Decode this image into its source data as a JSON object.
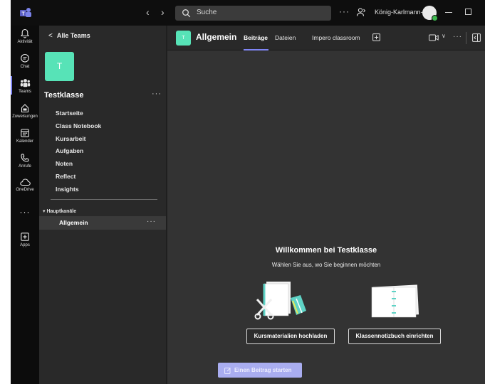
{
  "titlebar": {
    "search_placeholder": "Suche",
    "more": "···",
    "user_name": "König-Karlmann-...",
    "nav_back": "‹",
    "nav_forward": "›"
  },
  "rail": {
    "items": [
      {
        "label": "Aktivität"
      },
      {
        "label": "Chat"
      },
      {
        "label": "Teams"
      },
      {
        "label": "Zuweisungen"
      },
      {
        "label": "Kalender"
      },
      {
        "label": "Anrufe"
      },
      {
        "label": "OneDrive"
      },
      {
        "label": "Apps"
      }
    ],
    "more": "···"
  },
  "panel": {
    "back_label": "Alle Teams",
    "team_initial": "T",
    "team_name": "Testklasse",
    "team_more": "···",
    "nav": [
      "Startseite",
      "Class Notebook",
      "Kursarbeit",
      "Aufgaben",
      "Noten",
      "Reflect",
      "Insights"
    ],
    "section": "▾ Hauptkanäle",
    "channel": "Allgemein",
    "channel_more": "···"
  },
  "main": {
    "channel_initial": "T",
    "title": "Allgemein",
    "tabs": [
      "Beiträge",
      "Dateien",
      "Impero classroom"
    ],
    "head_chevron": "∨",
    "head_more": "···",
    "welcome_title": "Willkommen bei Testklasse",
    "welcome_sub": "Wählen Sie aus, wo Sie beginnen möchten",
    "btn_upload": "Kursmaterialien hochladen",
    "btn_notebook": "Klassennotizbuch einrichten",
    "btn_start": "Einen Beitrag starten"
  },
  "colors": {
    "accent": "#7f85f5",
    "team_color": "#57e3b7"
  }
}
